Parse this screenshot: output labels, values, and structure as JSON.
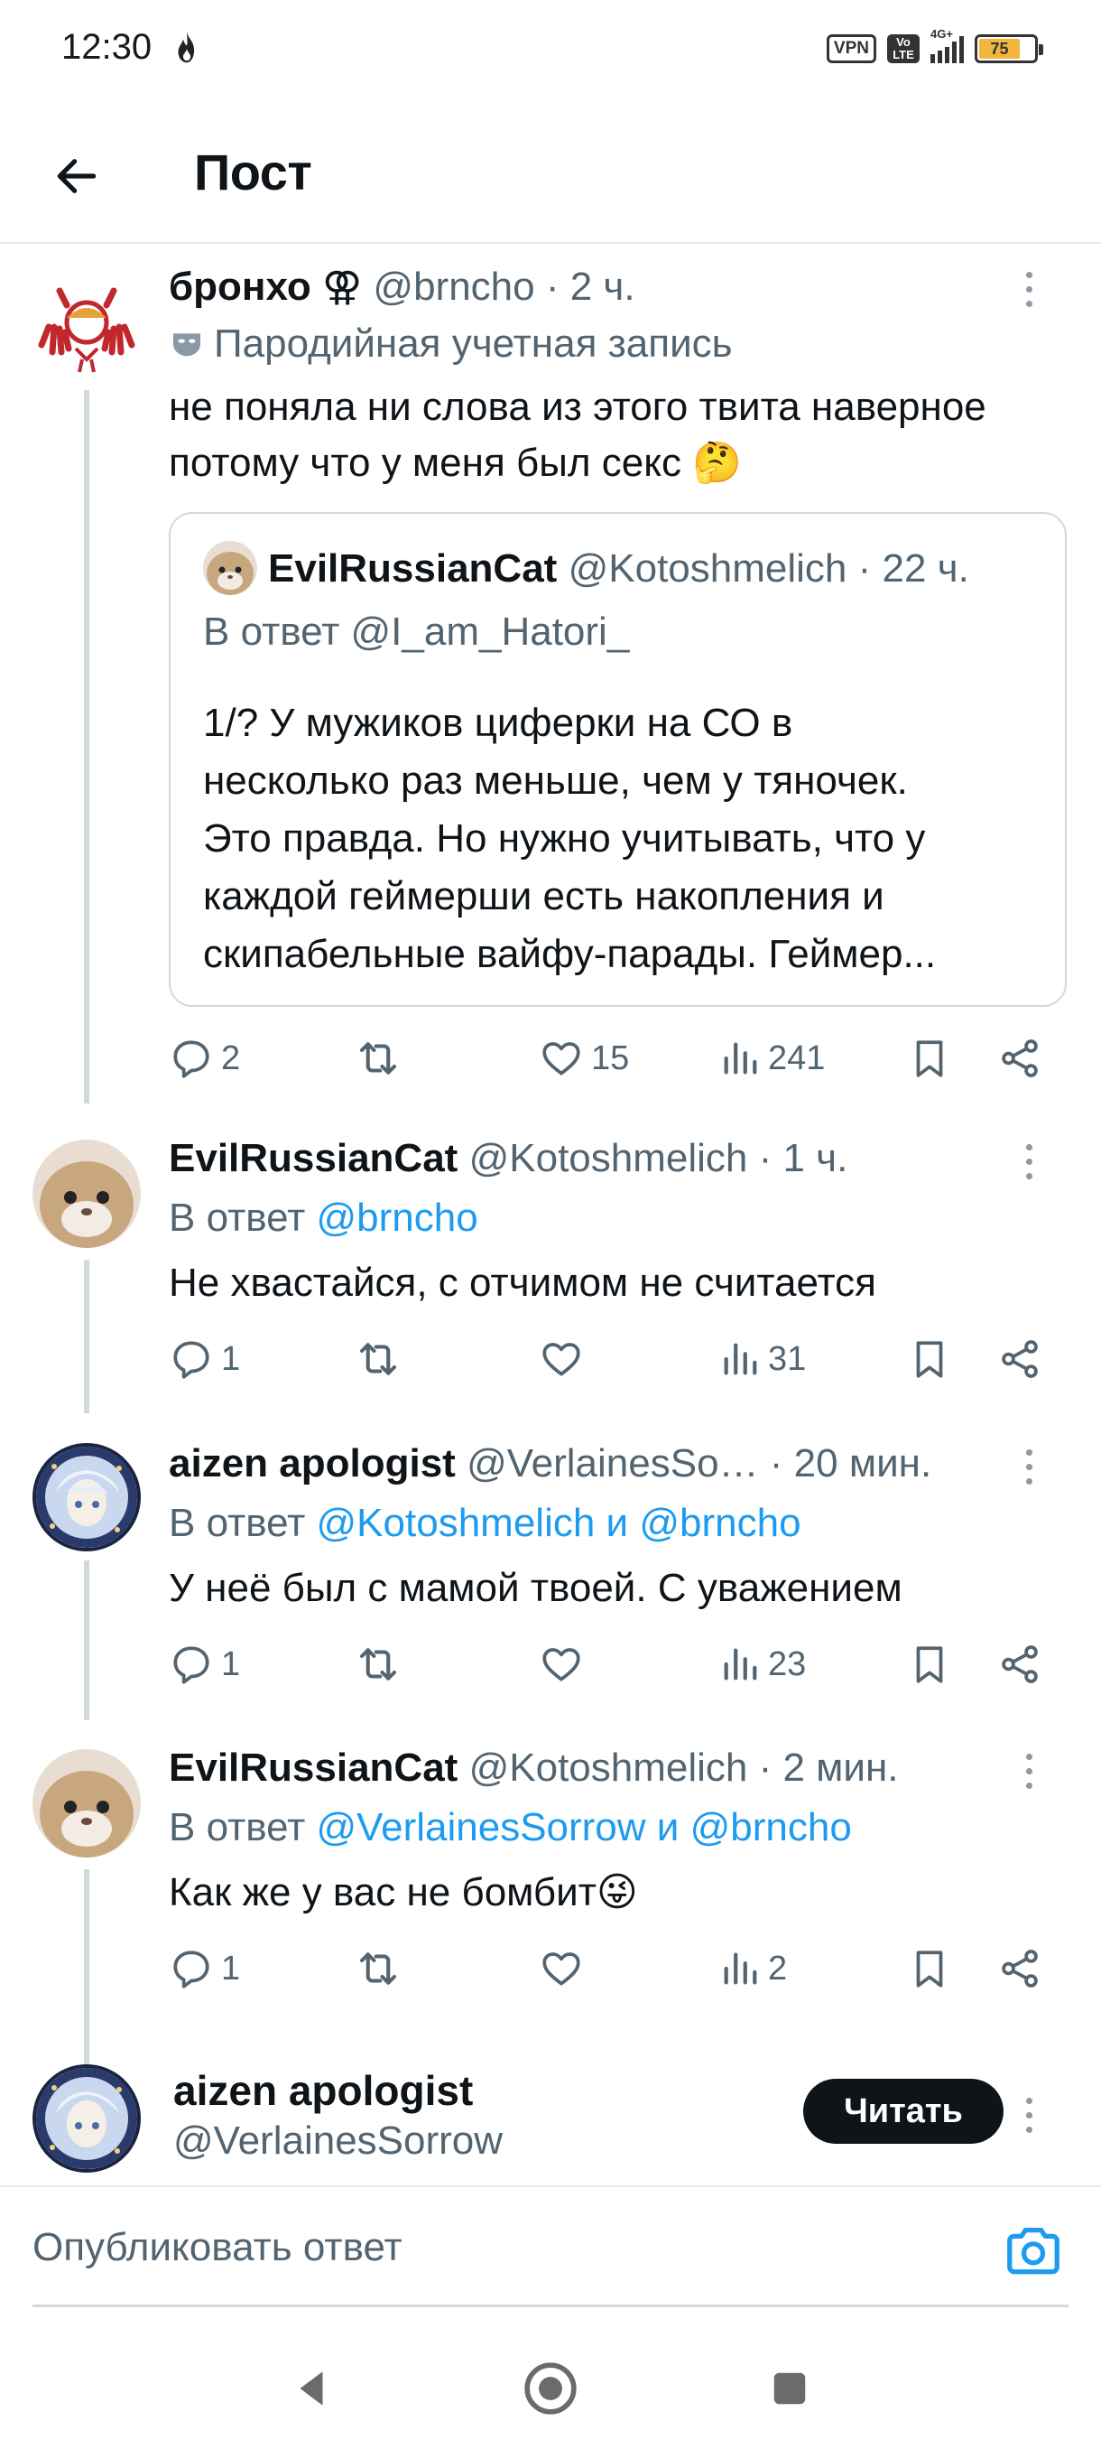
{
  "status_bar": {
    "time": "12:30",
    "vpn": "VPN",
    "volte": "Vo LTE",
    "network": "4G+",
    "battery": "75"
  },
  "header": {
    "title": "Пост"
  },
  "tweets": [
    {
      "name": "бронхо ⚢",
      "handle": "@brncho",
      "time": "· 2 ч.",
      "label": "Пародийная учетная запись",
      "text_lines": [
        "не поняла ни слова из этого твита наверное",
        "потому что у меня был секс 🤔"
      ],
      "replies": "2",
      "retweets": "",
      "likes": "15",
      "views": "241"
    },
    {
      "name": "EvilRussianCat",
      "handle": "@Kotoshmelich",
      "time": "· 1 ч.",
      "reply_prefix": "В ответ",
      "reply_to": "@brncho",
      "text": "Не хвастайся, с отчимом не считается",
      "replies": "1",
      "retweets": "",
      "likes": "",
      "views": "31"
    },
    {
      "name": "aizen apologist",
      "handle": "@VerlainesSo…",
      "time": "· 20 мин.",
      "reply_prefix": "В ответ",
      "reply_to": "@Kotoshmelich и @brncho",
      "text": "У неё был с мамой твоей. С уважением",
      "replies": "1",
      "retweets": "",
      "likes": "",
      "views": "23"
    },
    {
      "name": "EvilRussianCat",
      "handle": "@Kotoshmelich",
      "time": "· 2 мин.",
      "reply_prefix": "В ответ",
      "reply_to": "@VerlainesSorrow и @brncho",
      "text": "Как же у вас не бомбит😜",
      "replies": "1",
      "retweets": "",
      "likes": "",
      "views": "2"
    }
  ],
  "quote": {
    "name": "EvilRussianCat",
    "handle": "@Kotoshmelich",
    "time": "· 22 ч.",
    "reply_line": "В ответ @I_am_Hatori_",
    "text_lines": [
      "1/? У мужиков циферки на СО в",
      "несколько раз меньше, чем у тяночек.",
      "Это правда. Но нужно учитывать, что у",
      "каждой геймерши есть накопления и",
      "скипабельные вайфу-парады. Геймер..."
    ]
  },
  "profile_card": {
    "name": "aizen apologist",
    "handle": "@VerlainesSorrow",
    "follow_label": "Читать"
  },
  "compose": {
    "placeholder": "Опубликовать ответ"
  },
  "colors": {
    "link": "#1d9bf0",
    "secondary": "#536471",
    "thread_line": "#cfd9de",
    "button_dark": "#0f1419"
  }
}
